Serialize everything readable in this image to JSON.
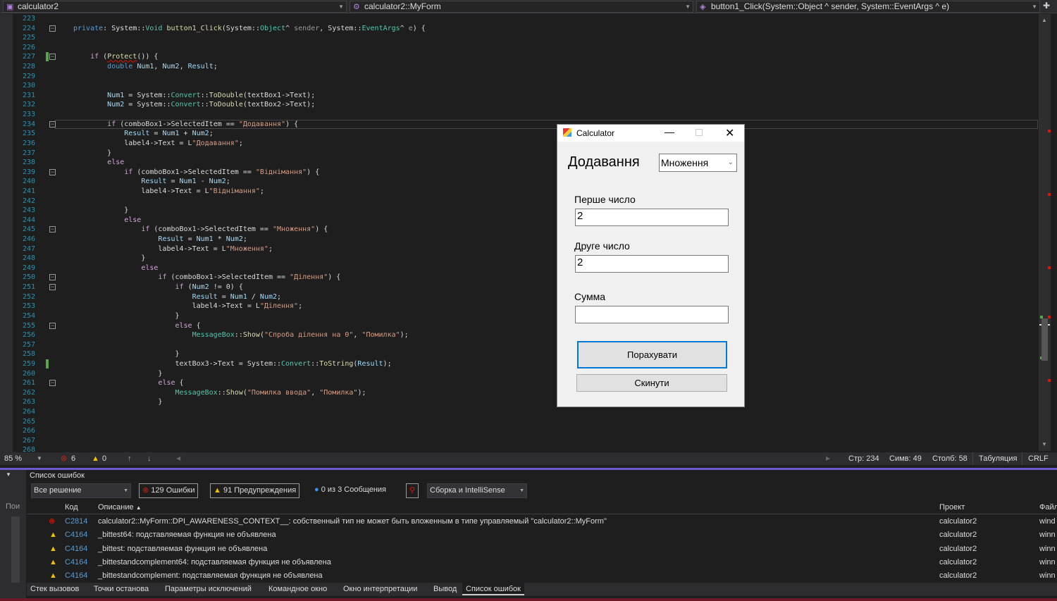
{
  "navbar": {
    "project": "calculator2",
    "class": "calculator2::MyForm",
    "member": "button1_Click(System::Object ^ sender, System::EventArgs ^ e)"
  },
  "editor": {
    "first_line": 223,
    "lines": [
      [],
      [
        [
          "private",
          "kw"
        ],
        [
          ": System::",
          ""
        ],
        [
          "Void",
          "ty"
        ],
        [
          " ",
          ""
        ],
        [
          "button1_Click",
          "fn"
        ],
        [
          "(System::",
          ""
        ],
        [
          "Object",
          "ty"
        ],
        [
          "^ ",
          ""
        ],
        [
          "sender",
          "prm"
        ],
        [
          ", System::",
          ""
        ],
        [
          "EventArgs",
          "ty"
        ],
        [
          "^ ",
          ""
        ],
        [
          "e",
          "prm"
        ],
        [
          ") {",
          ""
        ]
      ],
      [],
      [],
      [
        [
          "    ",
          ""
        ],
        [
          "if",
          "ctl"
        ],
        [
          " (",
          ""
        ],
        [
          "Protect",
          "fn squig"
        ],
        [
          "()) {",
          ""
        ]
      ],
      [
        [
          "        ",
          ""
        ],
        [
          "double",
          "kw"
        ],
        [
          " ",
          ""
        ],
        [
          "Num1",
          "var"
        ],
        [
          ", ",
          ""
        ],
        [
          "Num2",
          "var"
        ],
        [
          ", ",
          ""
        ],
        [
          "Result",
          "var"
        ],
        [
          ";",
          ""
        ]
      ],
      [],
      [],
      [
        [
          "        ",
          ""
        ],
        [
          "Num1",
          "var"
        ],
        [
          " = System::",
          ""
        ],
        [
          "Convert",
          "ty"
        ],
        [
          "::",
          ""
        ],
        [
          "ToDouble",
          "fn"
        ],
        [
          "(textBox1->Text);",
          ""
        ]
      ],
      [
        [
          "        ",
          ""
        ],
        [
          "Num2",
          "var"
        ],
        [
          " = System::",
          ""
        ],
        [
          "Convert",
          "ty"
        ],
        [
          "::",
          ""
        ],
        [
          "ToDouble",
          "fn"
        ],
        [
          "(textBox2->Text);",
          ""
        ]
      ],
      [],
      [
        [
          "        ",
          ""
        ],
        [
          "if",
          "ctl"
        ],
        [
          " (comboBox1->SelectedItem == ",
          ""
        ],
        [
          "\"Додавання\"",
          "str"
        ],
        [
          ") {",
          ""
        ]
      ],
      [
        [
          "            ",
          ""
        ],
        [
          "Result",
          "var"
        ],
        [
          " = ",
          ""
        ],
        [
          "Num1",
          "var"
        ],
        [
          " + ",
          ""
        ],
        [
          "Num2",
          "var"
        ],
        [
          ";",
          ""
        ]
      ],
      [
        [
          "            label4->Text = L",
          ""
        ],
        [
          "\"Додавання\"",
          "str"
        ],
        [
          ";",
          ""
        ]
      ],
      [
        [
          "        }",
          ""
        ]
      ],
      [
        [
          "        ",
          ""
        ],
        [
          "else",
          "ctl"
        ]
      ],
      [
        [
          "            ",
          ""
        ],
        [
          "if",
          "ctl"
        ],
        [
          " (comboBox1->SelectedItem == ",
          ""
        ],
        [
          "\"Віднімання\"",
          "str"
        ],
        [
          ") {",
          ""
        ]
      ],
      [
        [
          "                ",
          ""
        ],
        [
          "Result",
          "var"
        ],
        [
          " = ",
          ""
        ],
        [
          "Num1",
          "var"
        ],
        [
          " - ",
          ""
        ],
        [
          "Num2",
          "var"
        ],
        [
          ";",
          ""
        ]
      ],
      [
        [
          "                label4->Text = L",
          ""
        ],
        [
          "\"Віднімання\"",
          "str"
        ],
        [
          ";",
          ""
        ]
      ],
      [],
      [
        [
          "            }",
          ""
        ]
      ],
      [
        [
          "            ",
          ""
        ],
        [
          "else",
          "ctl"
        ]
      ],
      [
        [
          "                ",
          ""
        ],
        [
          "if",
          "ctl"
        ],
        [
          " (comboBox1->SelectedItem == ",
          ""
        ],
        [
          "\"Множення\"",
          "str"
        ],
        [
          ") {",
          ""
        ]
      ],
      [
        [
          "                    ",
          ""
        ],
        [
          "Result",
          "var"
        ],
        [
          " = ",
          ""
        ],
        [
          "Num1",
          "var"
        ],
        [
          " * ",
          ""
        ],
        [
          "Num2",
          "var"
        ],
        [
          ";",
          ""
        ]
      ],
      [
        [
          "                    label4->Text = L",
          ""
        ],
        [
          "\"Множення\"",
          "str"
        ],
        [
          ";",
          ""
        ]
      ],
      [
        [
          "                }",
          ""
        ]
      ],
      [
        [
          "                ",
          ""
        ],
        [
          "else",
          "ctl"
        ]
      ],
      [
        [
          "                    ",
          ""
        ],
        [
          "if",
          "ctl"
        ],
        [
          " (comboBox1->SelectedItem == ",
          ""
        ],
        [
          "\"Ділення\"",
          "str"
        ],
        [
          ") {",
          ""
        ]
      ],
      [
        [
          "                        ",
          ""
        ],
        [
          "if",
          "ctl"
        ],
        [
          " (",
          ""
        ],
        [
          "Num2",
          "var"
        ],
        [
          " != 0) {",
          ""
        ]
      ],
      [
        [
          "                            ",
          ""
        ],
        [
          "Result",
          "var"
        ],
        [
          " = ",
          ""
        ],
        [
          "Num1",
          "var"
        ],
        [
          " / ",
          ""
        ],
        [
          "Num2",
          "var"
        ],
        [
          ";",
          ""
        ]
      ],
      [
        [
          "                            label4->Text = L",
          ""
        ],
        [
          "\"Ділення\"",
          "str"
        ],
        [
          ";",
          ""
        ]
      ],
      [
        [
          "                        }",
          ""
        ]
      ],
      [
        [
          "                        ",
          ""
        ],
        [
          "else",
          "ctl"
        ],
        [
          " {",
          ""
        ]
      ],
      [
        [
          "                            ",
          ""
        ],
        [
          "MessageBox",
          "ty"
        ],
        [
          "::",
          ""
        ],
        [
          "Show",
          "fn"
        ],
        [
          "(",
          ""
        ],
        [
          "\"Спроба ділення на 0\"",
          "str"
        ],
        [
          ", ",
          ""
        ],
        [
          "\"Помилка\"",
          "str"
        ],
        [
          ");",
          ""
        ]
      ],
      [],
      [
        [
          "                        }",
          ""
        ]
      ],
      [
        [
          "                        textBox3->Text = System::",
          ""
        ],
        [
          "Convert",
          "ty"
        ],
        [
          "::",
          ""
        ],
        [
          "ToString",
          "fn"
        ],
        [
          "(",
          ""
        ],
        [
          "Result",
          "var"
        ],
        [
          ");",
          ""
        ]
      ],
      [
        [
          "                    }",
          ""
        ]
      ],
      [
        [
          "                    ",
          ""
        ],
        [
          "else",
          "ctl"
        ],
        [
          " {",
          ""
        ]
      ],
      [
        [
          "                        ",
          ""
        ],
        [
          "MessageBox",
          "ty"
        ],
        [
          "::",
          ""
        ],
        [
          "Show",
          "fn"
        ],
        [
          "(",
          ""
        ],
        [
          "\"Помилка ввода\"",
          "str"
        ],
        [
          ", ",
          ""
        ],
        [
          "\"Помилка\"",
          "str"
        ],
        [
          ");",
          ""
        ]
      ],
      [
        [
          "                    }",
          ""
        ]
      ],
      [],
      [],
      [],
      [],
      []
    ],
    "fold_lines": [
      224,
      227,
      234,
      239,
      245,
      250,
      251,
      255,
      261
    ],
    "changed_lines": [
      227,
      259
    ]
  },
  "status": {
    "zoom": "85 %",
    "errors": "6",
    "warnings": "0",
    "line": "Стр: 234",
    "char": "Симв: 49",
    "col": "Столб: 58",
    "tabs": "Табуляция",
    "eol": "CRLF"
  },
  "error_list": {
    "title": "Список ошибок",
    "scope": "Все решение",
    "errors_btn": "129 Ошибки",
    "warnings_btn": "91 Предупреждения",
    "messages_btn": "0 из 3 Сообщения",
    "source": "Сборка и IntelliSense",
    "side_label": "Пои",
    "columns": {
      "code": "Код",
      "description": "Описание",
      "project": "Проект",
      "file": "Файл"
    },
    "rows": [
      {
        "severity": "error",
        "code": "C2814",
        "description": "calculator2::MyForm::DPI_AWARENESS_CONTEXT__: собственный тип не может быть вложенным в типе управляемый \"calculator2::MyForm\"",
        "project": "calculator2",
        "file": "wind"
      },
      {
        "severity": "warning",
        "code": "C4164",
        "description": "_bittest64: подставляемая функция не объявлена",
        "project": "calculator2",
        "file": "winn"
      },
      {
        "severity": "warning",
        "code": "C4164",
        "description": "_bittest: подставляемая функция не объявлена",
        "project": "calculator2",
        "file": "winn"
      },
      {
        "severity": "warning",
        "code": "C4164",
        "description": "_bittestandcomplement64: подставляемая функция не объявлена",
        "project": "calculator2",
        "file": "winn"
      },
      {
        "severity": "warning",
        "code": "C4164",
        "description": "_bittestandcomplement: подставляемая функция не объявлена",
        "project": "calculator2",
        "file": "winn"
      }
    ]
  },
  "bottom_tabs": [
    "Стек вызовов",
    "Точки останова",
    "Параметры исключений",
    "Командное окно",
    "Окно интерпретации",
    "Вывод",
    "Список ошибок"
  ],
  "active_bottom_tab": "Список ошибок",
  "dialog": {
    "title": "Calculator",
    "operation_label": "Додавання",
    "operation_select": "Множення",
    "first_label": "Перше число",
    "first_value": "2",
    "second_label": "Друге число",
    "second_value": "2",
    "sum_label": "Сумма",
    "sum_value": "",
    "calc_button": "Порахувати",
    "reset_button": "Скинути"
  },
  "colors": {
    "error": "#e51400",
    "warning": "#f0c000",
    "accent": "#6a5acd",
    "change_bar": "#57a64a"
  }
}
